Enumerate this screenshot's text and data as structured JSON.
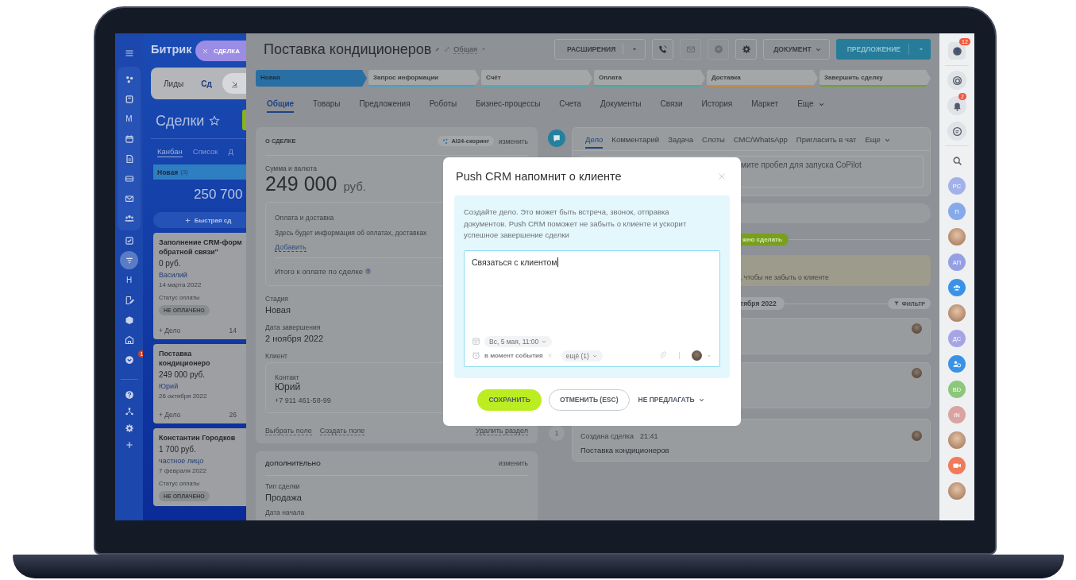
{
  "sidebar": {
    "letters": [
      "М",
      "Н"
    ],
    "badge": "1"
  },
  "kanban": {
    "logo": "Битрик",
    "entity_tag": "СДЕЛКА",
    "tabs": [
      {
        "label": "Лиды",
        "selected": false
      },
      {
        "label": "Сд",
        "selected": true
      }
    ],
    "title": "Сделки",
    "views": [
      {
        "label": "Канбан",
        "selected": true
      },
      {
        "label": "Список",
        "selected": false
      },
      {
        "label": "Д",
        "selected": false
      }
    ],
    "column": {
      "title": "Новая",
      "count": "(3)",
      "total": "250 700",
      "quick_add": "Быстрая сд"
    },
    "cards": [
      {
        "title": "Заполнение CRM-форм обратной связи\"",
        "amount": "0 руб.",
        "contact": "Василий",
        "date": "14 марта 2022",
        "status_label": "Статус оплаты",
        "status": "НЕ ОПЛАЧЕНО",
        "add": "+ Дело",
        "day": "14"
      },
      {
        "title": "Поставка кондиционеро",
        "amount": "249 000 руб.",
        "contact": "Юрий",
        "date": "26 октября 2022",
        "add": "+ Дело",
        "day": "26"
      },
      {
        "title": "Константин Городков",
        "amount": "1 700 руб.",
        "contact": "частное лицо",
        "date": "7 февраля 2022",
        "status_label": "Статус оплаты",
        "status": "НЕ ОПЛАЧЕНО"
      }
    ]
  },
  "deal": {
    "title": "Поставка кондиционеров",
    "category": "Общая",
    "toolbar": {
      "extensions": "РАСШИРЕНИЯ",
      "document": "ДОКУМЕНТ",
      "offer": "ПРЕДЛОЖЕНИЕ"
    },
    "stages": [
      {
        "label": "Новая",
        "color": "#2a6fa3",
        "selected": true
      },
      {
        "label": "Запрос информации",
        "color": "#3aa6c9",
        "selected": false
      },
      {
        "label": "Счёт",
        "color": "#3ab5c4",
        "selected": false
      },
      {
        "label": "Оплата",
        "color": "#35b49d",
        "selected": false
      },
      {
        "label": "Доставка",
        "color": "#d08a2c",
        "selected": false
      },
      {
        "label": "Завершить сделку",
        "color": "#6aa52a",
        "selected": false
      }
    ],
    "tabs": [
      {
        "label": "Общие",
        "selected": true
      },
      {
        "label": "Товары",
        "selected": false
      },
      {
        "label": "Предложения",
        "selected": false
      },
      {
        "label": "Роботы",
        "selected": false
      },
      {
        "label": "Бизнес-процессы",
        "selected": false
      },
      {
        "label": "Счета",
        "selected": false
      },
      {
        "label": "Документы",
        "selected": false
      },
      {
        "label": "Связи",
        "selected": false
      },
      {
        "label": "История",
        "selected": false
      },
      {
        "label": "Маркет",
        "selected": false
      },
      {
        "label": "Еще",
        "selected": false
      }
    ],
    "about": {
      "title": "О СДЕЛКЕ",
      "scoring": "AI24-скоринг",
      "edit": "изменить",
      "amount_label": "Сумма и валюта",
      "amount": "249 000",
      "currency": "руб.",
      "payment": {
        "title": "Оплата и доставка",
        "text": "Здесь будет информация об оплатах, доставках",
        "add": "Добавить",
        "total": "Итого к оплате по сделке"
      },
      "fields": [
        {
          "label": "Стадия",
          "value": "Новая"
        },
        {
          "label": "Дата завершения",
          "value": "2 ноября 2022"
        }
      ],
      "client_label": "Клиент",
      "contact": {
        "label": "Контакт",
        "name": "Юрий",
        "phone": "+7 911 461-58-99"
      },
      "links": [
        "Выбрать поле",
        "Создать поле"
      ],
      "delete": "Удалить раздел"
    },
    "extra": {
      "title": "ДОПОЛНИТЕЛЬНО",
      "edit": "изменить",
      "fields": [
        {
          "label": "Тип сделки",
          "value": "Продажа"
        },
        {
          "label": "Дата начала"
        }
      ]
    }
  },
  "timeline": {
    "tabs": [
      {
        "label": "Дело",
        "selected": true
      },
      {
        "label": "Комментарий",
        "selected": false
      },
      {
        "label": "Задача",
        "selected": false
      },
      {
        "label": "Слоты",
        "selected": false
      },
      {
        "label": "СМС/WhatsApp",
        "selected": false
      },
      {
        "label": "Пригласить в чат",
        "selected": false
      },
      {
        "label": "Еще",
        "selected": false
      }
    ],
    "placeholder": "мите пробел для запуска CoPilot",
    "badge": "жно сделать",
    "banner": ", чтобы не забыть о клиенте",
    "date": "тября 2022",
    "filter": "ФИЛЬТР",
    "event": {
      "marker": "1",
      "title": "Создана сделка",
      "time": "21:41",
      "text": "Поставка кондиционеров"
    }
  },
  "right_bar": {
    "help_badge": "12",
    "bell_badge": "2",
    "avatars": [
      {
        "initials": "РС",
        "color": "#a3b1ea"
      },
      {
        "initials": "П",
        "color": "#86a9ea"
      },
      {
        "initials": "АП",
        "color": "#95a0e4"
      },
      {
        "initials": "ДС",
        "color": "#a6a4e4"
      },
      {
        "initials": "BD",
        "color": "#8cc77a"
      },
      {
        "initials": "IN",
        "color": "#d9a3a0"
      }
    ]
  },
  "modal": {
    "title": "Push CRM напомнит о клиенте",
    "info": "Создайте дело. Это может быть встреча, звонок, отправка документов. Push CRM поможет не забыть о клиенте и ускорит успешное завершение сделки",
    "value": "Связаться с клиентом",
    "date": "Вс, 5 мая, 11:00",
    "reminder": "в момент события",
    "more": "ещё (1)",
    "buttons": [
      {
        "label": "СОХРАНИТЬ",
        "kind": "primary"
      },
      {
        "label": "ОТМЕНИТЬ (ESC)",
        "kind": "secondary"
      },
      {
        "label": "НЕ ПРЕДЛАГАТЬ",
        "kind": "link"
      }
    ]
  }
}
